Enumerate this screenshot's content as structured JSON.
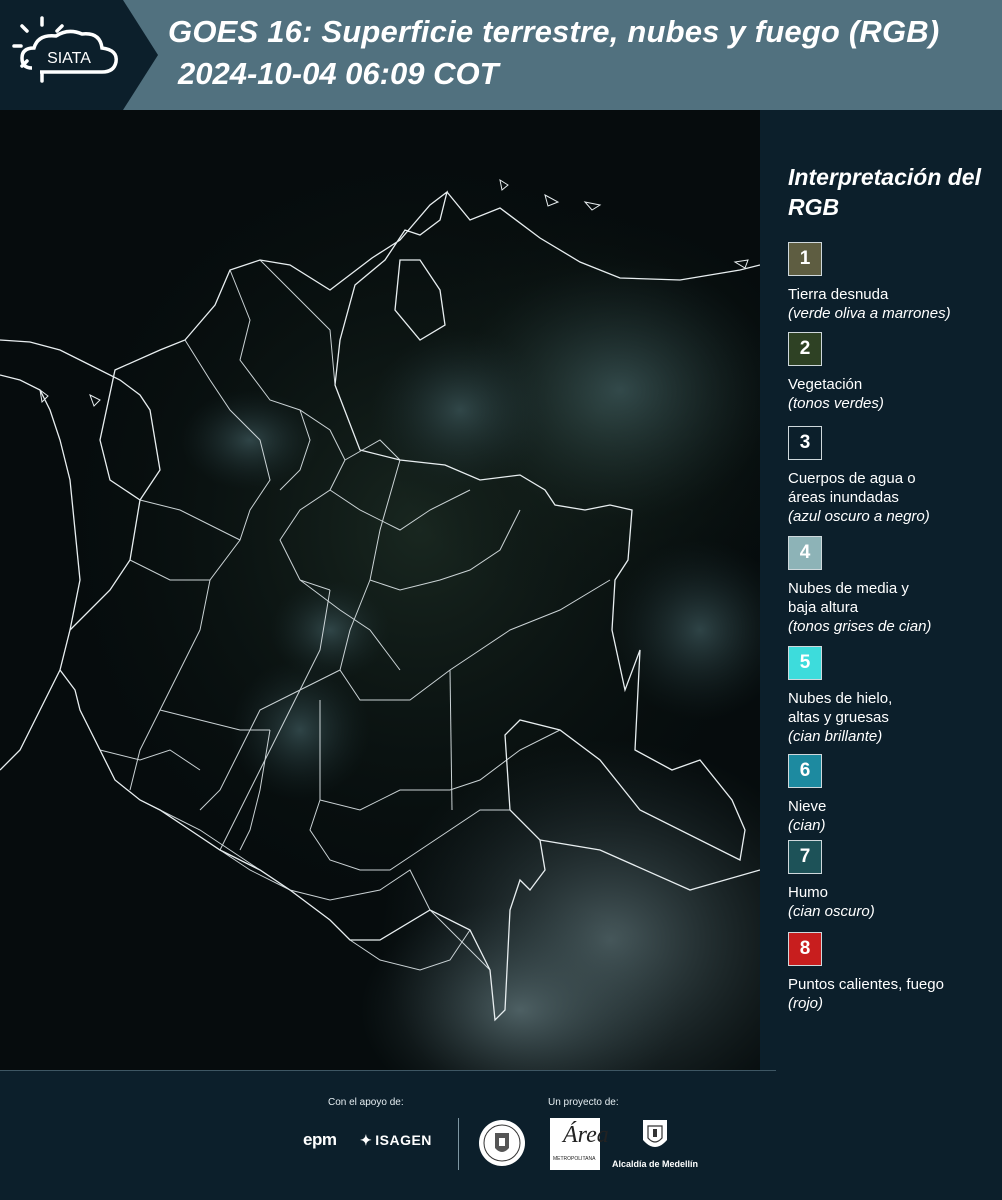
{
  "header": {
    "logo_text": "SIATA",
    "title": "GOES 16: Superficie terrestre, nubes y fuego (RGB)",
    "datetime": "2024-10-04 06:09 COT"
  },
  "legend": {
    "title": "Interpretación del RGB",
    "items": [
      {
        "number": "1",
        "label": "Tierra desnuda",
        "desc": "(verde oliva a marrones)",
        "color": "#5e5d41"
      },
      {
        "number": "2",
        "label": "Vegetación",
        "desc": "(tonos verdes)",
        "color": "#2e4124"
      },
      {
        "number": "3",
        "label": "Cuerpos de agua o\náreas inundadas",
        "desc": "(azul oscuro a negro)",
        "color": "#0c1f2b"
      },
      {
        "number": "4",
        "label": "Nubes de media y\nbaja altura",
        "desc": "(tonos grises de cian)",
        "color": "#8db3b7"
      },
      {
        "number": "5",
        "label": "Nubes de hielo,\naltas y gruesas",
        "desc": "(cian brillante)",
        "color": "#3ddcdc"
      },
      {
        "number": "6",
        "label": "Nieve",
        "desc": "(cian)",
        "color": "#1d8aa0"
      },
      {
        "number": "7",
        "label": "Humo",
        "desc": "(cian oscuro)",
        "color": "#1d5258"
      },
      {
        "number": "8",
        "label": "Puntos calientes, fuego",
        "desc": "(rojo)",
        "color": "#c81e1e"
      }
    ]
  },
  "footer": {
    "support_label": "Con el apoyo de:",
    "project_label": "Un proyecto de:",
    "sponsors": [
      "epm",
      "ISAGEN"
    ],
    "area_logo_text": "Área",
    "area_logo_subtext": "METROPOLITANA",
    "alcaldia_label": "Alcaldía de Medellín"
  }
}
